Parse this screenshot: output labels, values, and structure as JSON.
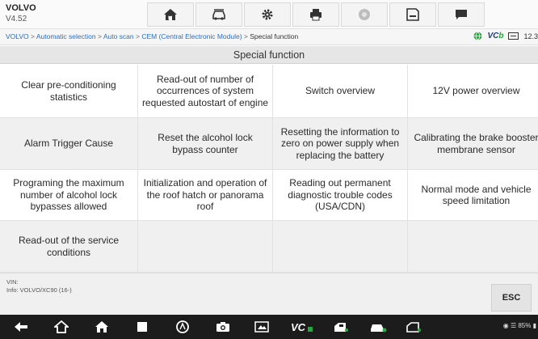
{
  "app": {
    "name": "VOLVO",
    "version": "V4.52"
  },
  "toolbar": {
    "items": [
      {
        "name": "home-button",
        "icon": "home-icon"
      },
      {
        "name": "vehicle-swap-button",
        "icon": "car-swap-icon"
      },
      {
        "name": "settings-button",
        "icon": "gear-icon"
      },
      {
        "name": "print-button",
        "icon": "printer-icon"
      },
      {
        "name": "help-button",
        "icon": "help-icon"
      },
      {
        "name": "save-button",
        "icon": "save-icon"
      },
      {
        "name": "data-logging-button",
        "icon": "message-icon"
      }
    ]
  },
  "breadcrumb": {
    "links": [
      "VOLVO",
      "Automatic selection",
      "Auto scan",
      "CEM (Central Electronic Module)"
    ],
    "separator": " > ",
    "current": "Special function"
  },
  "status_right": {
    "vcb_label": "VC",
    "vcb_accent": "b",
    "battery_text": "12.3"
  },
  "section_title": "Special function",
  "functions": [
    "Clear pre-conditioning statistics",
    "Read-out of number of occurrences of system requested autostart of engine",
    "Switch overview",
    "12V power overview",
    "Alarm Trigger Cause",
    "Reset the alcohol lock bypass counter",
    "Resetting the information to zero on power supply when replacing the battery",
    "Calibrating the brake booster membrane sensor",
    "Programing the maximum number of alcohol lock bypasses allowed",
    "Initialization and operation of the roof hatch or panorama roof",
    "Reading out permanent diagnostic trouble codes (USA/CDN)",
    "Normal mode and vehicle speed limitation",
    "Read-out of the service conditions",
    "",
    "",
    ""
  ],
  "footer": {
    "vin_label": "VIN:",
    "info_label": "Info: VOLVO/XC90 (16-)",
    "esc_label": "ESC"
  },
  "navbar": {
    "icons": [
      "back-icon",
      "home-icon",
      "autel-home-icon",
      "recent-apps-icon",
      "browser-icon",
      "camera-icon",
      "screenshot-icon",
      "vci-icon",
      "car-shortcut-icon",
      "car-shortcut-2-icon",
      "car-shortcut-3-icon"
    ],
    "status_text": "85%"
  },
  "colors": {
    "link": "#2b6fc0",
    "vcb_blue": "#1a3c80",
    "vcb_green": "#2aa640",
    "navbar": "#1c1c1c"
  }
}
